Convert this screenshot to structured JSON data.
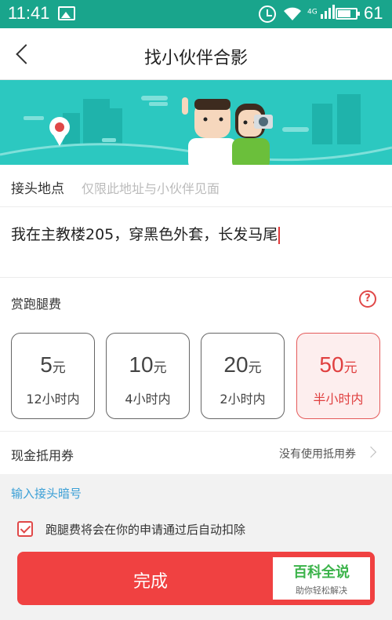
{
  "status_bar": {
    "time": "11:41",
    "network": "4G",
    "battery_level": "61"
  },
  "header": {
    "title": "找小伙伴合影"
  },
  "location": {
    "label": "接头地点",
    "hint": "仅限此地址与小伙伴见面"
  },
  "description": {
    "value": "我在主教楼205，穿黑色外套，长发马尾"
  },
  "fee": {
    "label": "赏跑腿费",
    "options": [
      {
        "amount": "5",
        "unit": "元",
        "duration": "12小时内",
        "selected": false
      },
      {
        "amount": "10",
        "unit": "元",
        "duration": "4小时内",
        "selected": false
      },
      {
        "amount": "20",
        "unit": "元",
        "duration": "2小时内",
        "selected": false
      },
      {
        "amount": "50",
        "unit": "元",
        "duration": "半小时内",
        "selected": true
      }
    ]
  },
  "coupon": {
    "label": "现金抵用券",
    "value": "没有使用抵用券"
  },
  "code_link": "输入接头暗号",
  "agreement": {
    "checked": true,
    "text": "跑腿费将会在你的申请通过后自动扣除"
  },
  "submit_label": "完成",
  "watermark": {
    "line1": "百科全说",
    "line2": "助你轻松解决"
  },
  "colors": {
    "status_bar": "#19a58c",
    "banner": "#2cc8c0",
    "accent_red": "#f04141",
    "link_blue": "#3a9fd6"
  }
}
